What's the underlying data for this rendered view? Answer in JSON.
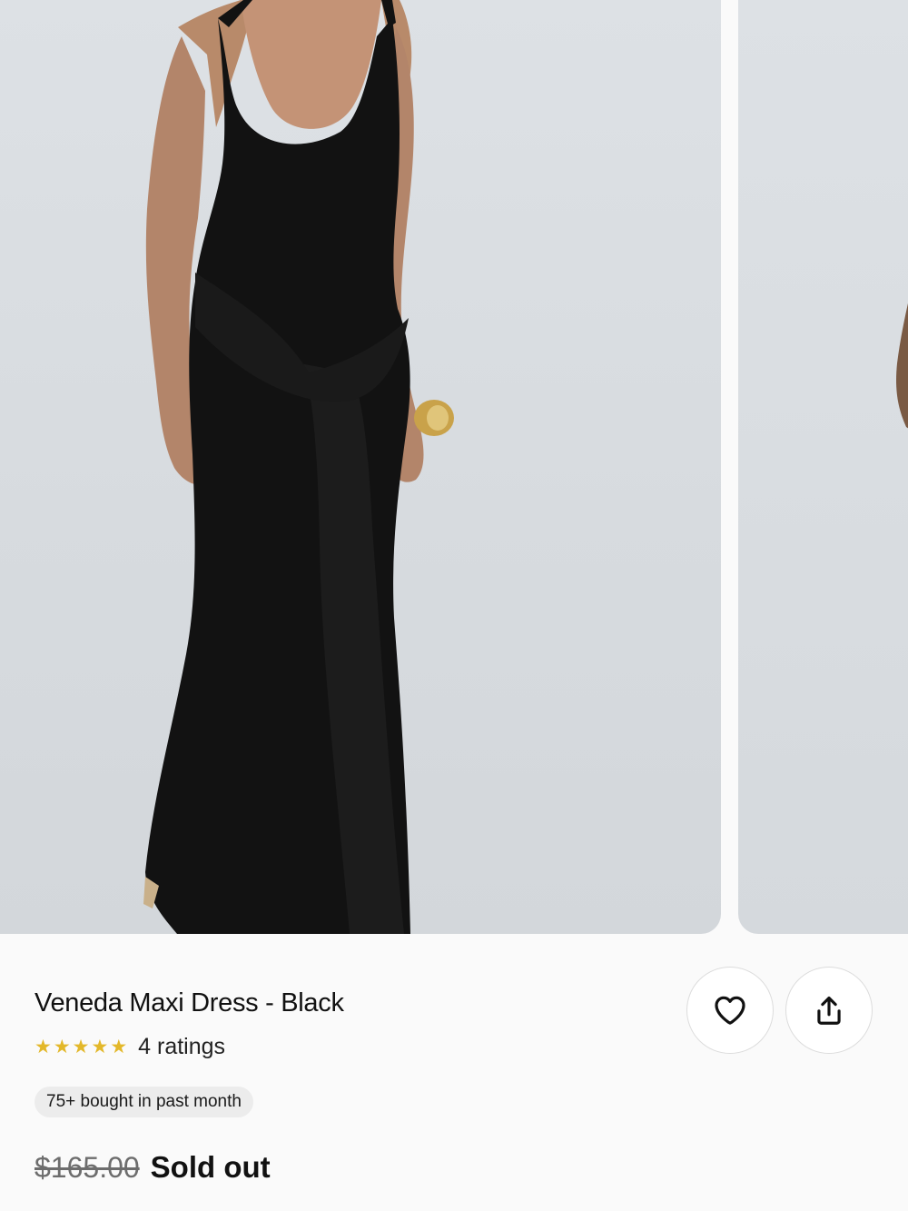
{
  "product": {
    "title": "Veneda Maxi Dress - Black",
    "rating_stars": 5,
    "rating_text": "4 ratings",
    "badge": "75+ bought in past month",
    "original_price": "$165.00",
    "status": "Sold out"
  },
  "actions": {
    "favorite_icon": "heart-icon",
    "share_icon": "share-icon"
  },
  "colors": {
    "star": "#e3b82a",
    "image_background": "#dadee2",
    "dress": "#111111"
  }
}
